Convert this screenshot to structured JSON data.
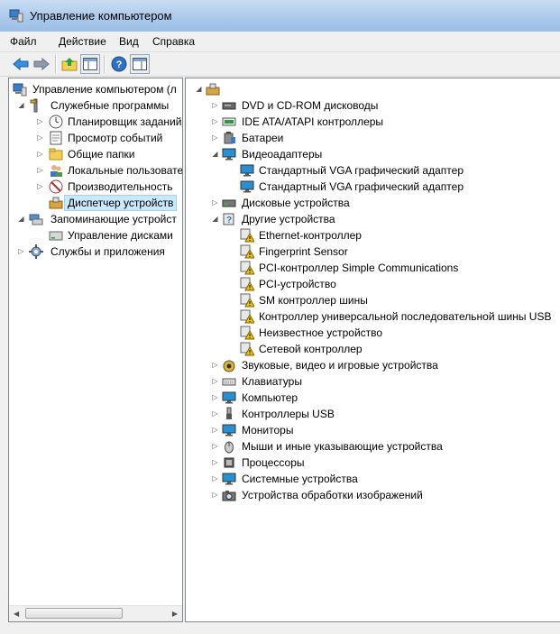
{
  "window": {
    "title": "Управление компьютером"
  },
  "menu": {
    "file": "Файл",
    "action": "Действие",
    "view": "Вид",
    "help": "Справка"
  },
  "left_tree": {
    "root": "Управление компьютером (л",
    "system_tools": "Служебные программы",
    "task_scheduler": "Планировщик заданий",
    "event_viewer": "Просмотр событий",
    "shared_folders": "Общие папки",
    "local_users": "Локальные пользовате",
    "performance": "Производительность",
    "device_manager": "Диспетчер устройств",
    "storage": "Запоминающие устройст",
    "disk_management": "Управление дисками",
    "services_apps": "Службы и приложения"
  },
  "device_tree": {
    "dvd": "DVD и CD-ROM дисководы",
    "ide": "IDE ATA/ATAPI контроллеры",
    "batteries": "Батареи",
    "video": "Видеоадаптеры",
    "vga1": "Стандартный VGA графический адаптер",
    "vga2": "Стандартный VGA графический адаптер",
    "disks": "Дисковые устройства",
    "other": "Другие устройства",
    "ethernet": "Ethernet-контроллер",
    "fingerprint": "Fingerprint Sensor",
    "pci_simple": "PCI-контроллер Simple Communications",
    "pci_device": "PCI-устройство",
    "sm_bus": "SM контроллер шины",
    "usb_universal": "Контроллер универсальной последовательной шины USB",
    "unknown": "Неизвестное устройство",
    "network": "Сетевой контроллер",
    "sound": "Звуковые, видео и игровые устройства",
    "keyboards": "Клавиатуры",
    "computer": "Компьютер",
    "usb": "Контроллеры USB",
    "monitors": "Мониторы",
    "mice": "Мыши и иные указывающие устройства",
    "processors": "Процессоры",
    "system_devices": "Системные устройства",
    "imaging": "Устройства обработки изображений"
  },
  "colors": {
    "selection": "#cce8ff",
    "selection_border": "#99d1ff",
    "title_bar": "#a9c8ea",
    "warning": "#f5c400"
  }
}
